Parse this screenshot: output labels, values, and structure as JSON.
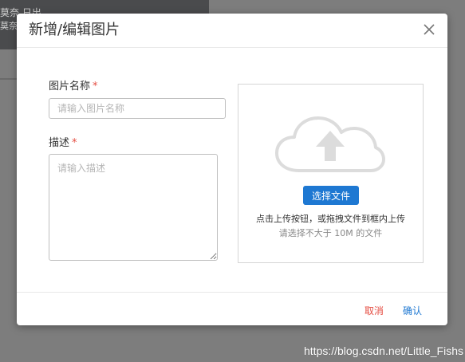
{
  "background": {
    "line1": "莫奈  日出",
    "line2": "莫奈"
  },
  "modal": {
    "title": "新增/编辑图片",
    "close_icon": "close-icon",
    "fields": {
      "name_label": "图片名称",
      "name_placeholder": "请输入图片名称",
      "desc_label": "描述",
      "desc_placeholder": "请输入描述",
      "required_mark": "*"
    },
    "upload": {
      "icon": "cloud-upload-icon",
      "button": "选择文件",
      "hint": "点击上传按钮，或拖拽文件到框内上传",
      "size_hint": "请选择不大于 10M 的文件"
    },
    "footer": {
      "cancel": "取消",
      "confirm": "确认"
    }
  },
  "watermark": "https://blog.csdn.net/Little_Fishs",
  "colors": {
    "primary": "#1e78d2",
    "danger": "#e54d42",
    "overlay": "#7d7d7d"
  }
}
